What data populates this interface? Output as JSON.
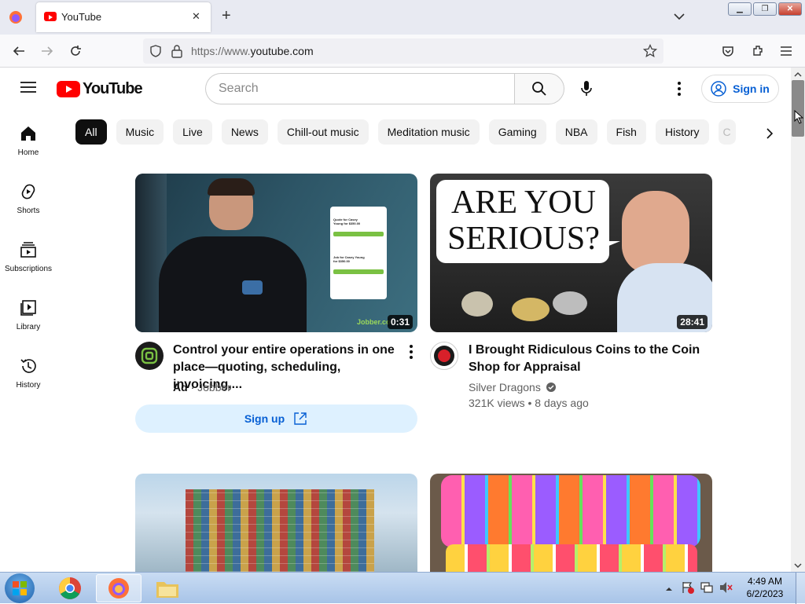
{
  "browser": {
    "tab_title": "YouTube",
    "url_prefix": "https://www.",
    "url_domain": "youtube.com",
    "tab_close": "✕",
    "new_tab": "+"
  },
  "youtube": {
    "logo_text": "YouTube",
    "search_placeholder": "Search",
    "signin_label": "Sign in",
    "chips": [
      "All",
      "Music",
      "Live",
      "News",
      "Chill-out music",
      "Meditation music",
      "Gaming",
      "NBA",
      "Fish",
      "History",
      "C"
    ],
    "nav": [
      {
        "label": "Home"
      },
      {
        "label": "Shorts"
      },
      {
        "label": "Subscriptions"
      },
      {
        "label": "Library"
      },
      {
        "label": "History"
      }
    ],
    "ad": {
      "thumb_brand": "Jobber.co",
      "duration": "0:31",
      "title_line1": "Control your entire operations in one",
      "title_line2": "place—quoting, scheduling, invoicing,...",
      "ad_label": "Ad",
      "advertiser": "Jobber",
      "cta": "Sign up",
      "card_quote": "Quote for Casey Young for $350.00",
      "card_job": "Job for Casey Young for $350.00"
    },
    "video": {
      "thumb_text_1": "ARE YOU",
      "thumb_text_2": "SERIOUS?",
      "duration": "28:41",
      "title_line1": "I Brought Ridiculous Coins to the Coin",
      "title_line2": "Shop for Appraisal",
      "channel": "Silver Dragons",
      "views": "321K views",
      "age": "8 days ago",
      "separator": "•"
    }
  },
  "taskbar": {
    "time": "4:49 AM",
    "date": "6/2/2023"
  },
  "colors": {
    "yt_red": "#ff0000",
    "link_blue": "#065fd4",
    "signup_bg": "#def1ff"
  }
}
